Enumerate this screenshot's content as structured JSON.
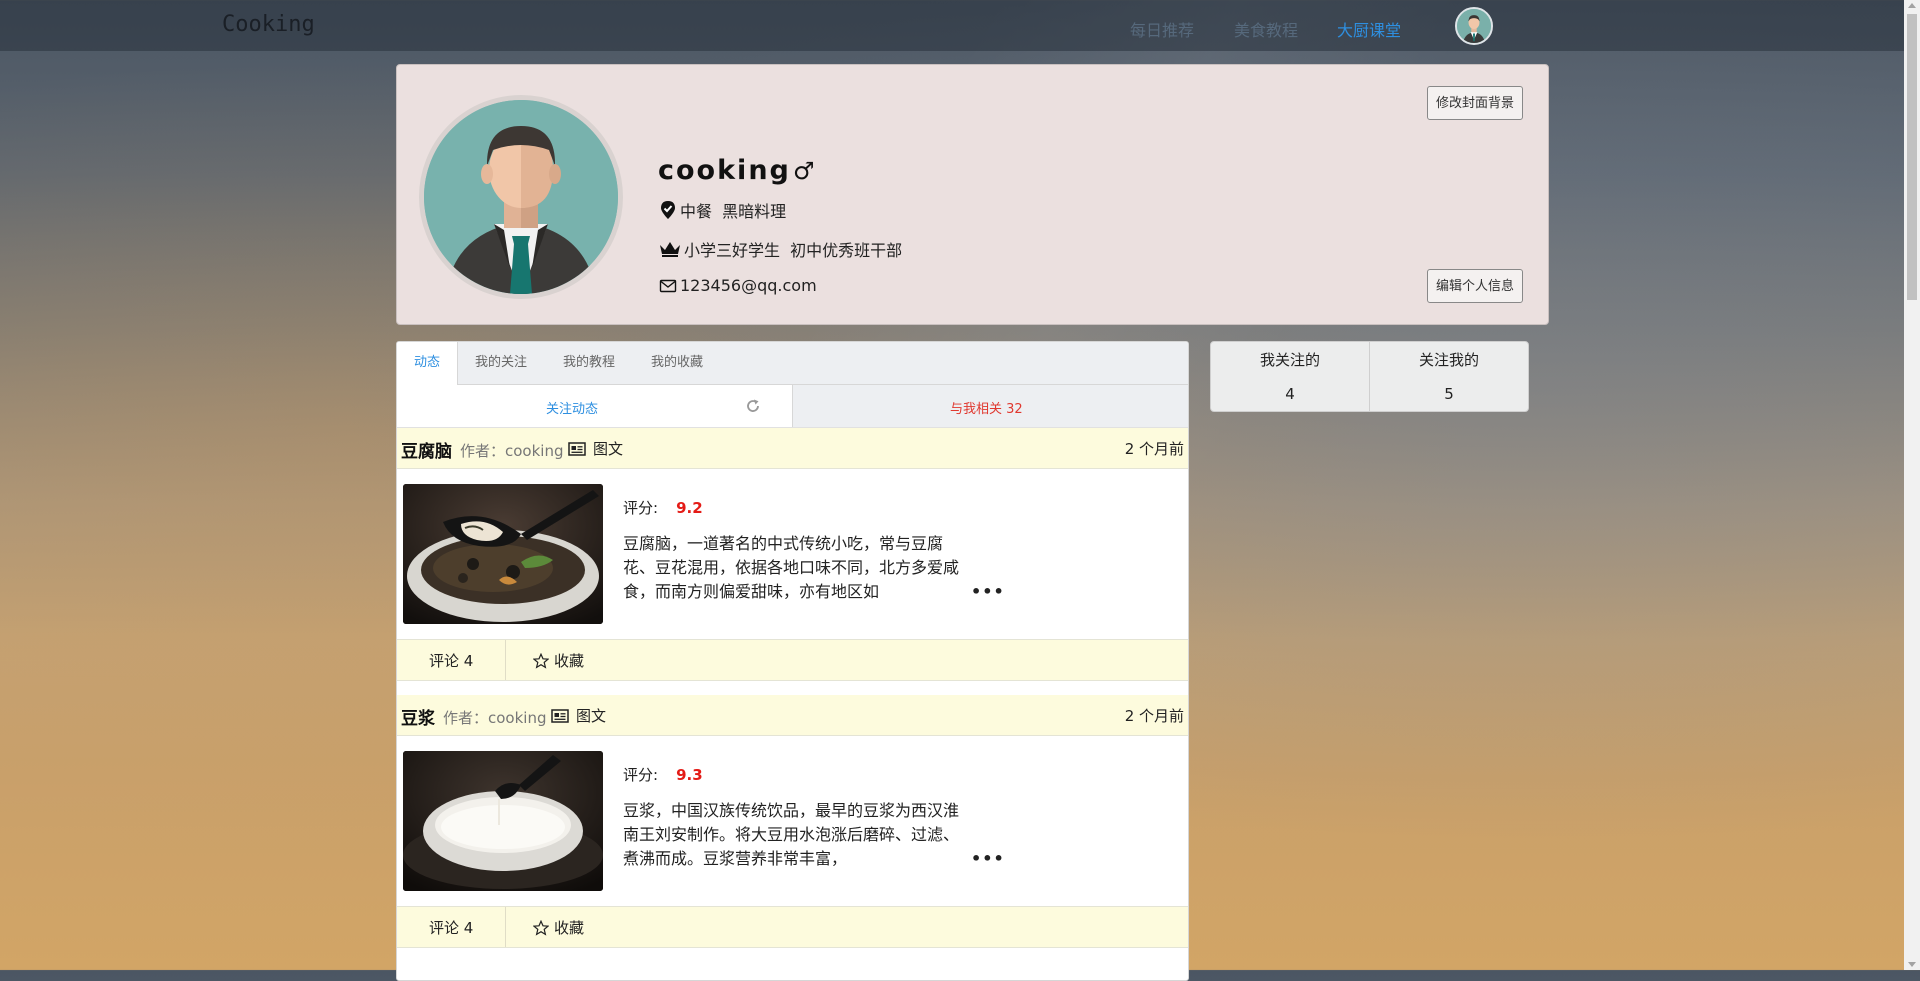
{
  "nav": {
    "logo": "Cooking",
    "links": [
      "每日推荐",
      "美食教程",
      "大厨课堂"
    ],
    "active_index": 2
  },
  "profile": {
    "name": "cooking",
    "gender_symbol": "♂",
    "cuisines": "中餐  黑暗料理",
    "honors": "小学三好学生  初中优秀班干部",
    "email": "123456@qq.com",
    "btn_cover": "修改封面背景",
    "btn_edit": "编辑个人信息"
  },
  "tabs": [
    "动态",
    "我的关注",
    "我的教程",
    "我的收藏"
  ],
  "subtabs": {
    "left": "关注动态",
    "right": "与我相关 32"
  },
  "feeds": [
    {
      "title": "豆腐脑",
      "author": "作者：cooking",
      "type": "图文",
      "time": "2 个月前",
      "score_label": "评分:",
      "score": "9.2",
      "desc": "豆腐脑，一道著名的中式传统小吃，常与豆腐花、豆花混用，依据各地口味不同，北方多爱咸食，而南方则偏爱甜味，亦有地区如",
      "comments": "评论 4",
      "fav": "收藏"
    },
    {
      "title": "豆浆",
      "author": "作者：cooking",
      "type": "图文",
      "time": "2 个月前",
      "score_label": "评分:",
      "score": "9.3",
      "desc": "豆浆，中国汉族传统饮品，最早的豆浆为西汉淮南王刘安制作。将大豆用水泡涨后磨碎、过滤、煮沸而成。豆浆营养非常丰富，",
      "comments": "评论 4",
      "fav": "收藏"
    }
  ],
  "follow": {
    "following_label": "我关注的",
    "following_count": "4",
    "followers_label": "关注我的",
    "followers_count": "5"
  },
  "colors": {
    "accent": "#2e8fe0",
    "score_red": "#e41b16",
    "card_bg": "#ebe0df",
    "feed_bar": "#fdfbdd"
  }
}
